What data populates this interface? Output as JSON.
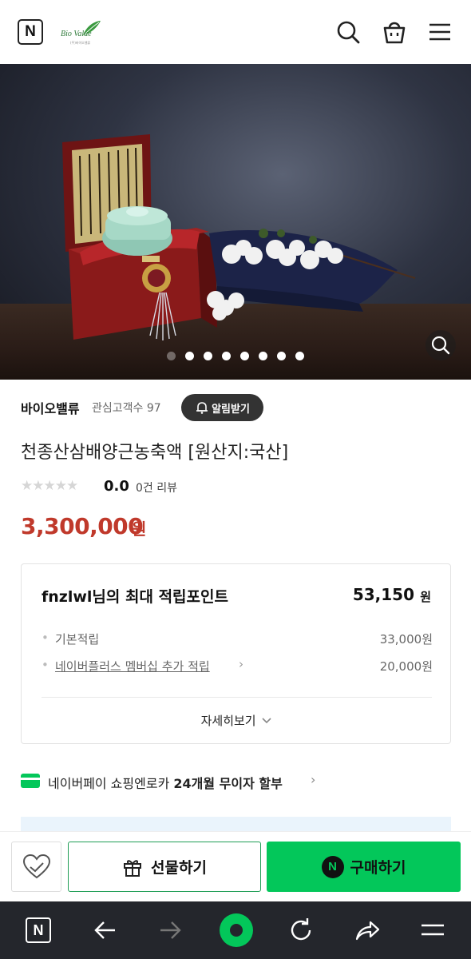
{
  "colors": {
    "accent_green": "#03c75a",
    "price_red": "#c0392b",
    "nav_bg": "#24262c"
  },
  "header": {
    "naver_logo_letter": "N",
    "brand_logo_text": "Bio Value",
    "brand_logo_subtext": "(주)바이오밸류",
    "icons": [
      "search-icon",
      "shopping-bag-icon",
      "hamburger-menu-icon"
    ]
  },
  "hero": {
    "carousel_total": 8,
    "carousel_active_index": 0
  },
  "seller": {
    "name": "바이오밸류",
    "favorite_label": "관심고객수 97",
    "alarm_button": "알림받기"
  },
  "product": {
    "title": "천종산삼배양근농축액 [원산지:국산]",
    "stars": "★★★★★",
    "rating_value": 0.0,
    "rating": "0.0",
    "review_count": "0건 리뷰",
    "price": "3,300,000",
    "price_unit": "원"
  },
  "points": {
    "title": "fnzlwl님의 최대 적립포인트",
    "total": "53,150",
    "total_unit": "원",
    "rows": [
      {
        "bullet": "•",
        "label": "기본적립",
        "value": "33,000원"
      },
      {
        "bullet": "•",
        "label": "네이버플러스 멤버십 추가 적립",
        "value": "20,000원"
      }
    ],
    "more": "자세히보기"
  },
  "naverpay": {
    "text_plain": "네이버페이 쇼핑엔로카 ",
    "text_bold": "24개월 무이자 할부"
  },
  "actions": {
    "gift": "선물하기",
    "buy": "구매하기",
    "buy_icon_letter": "N"
  },
  "browser_nav": {
    "n_letter": "N",
    "icons": [
      "naver-home-icon",
      "back-arrow-icon",
      "forward-arrow-icon",
      "green-dot-icon",
      "reload-icon",
      "share-icon",
      "menu-icon"
    ]
  }
}
